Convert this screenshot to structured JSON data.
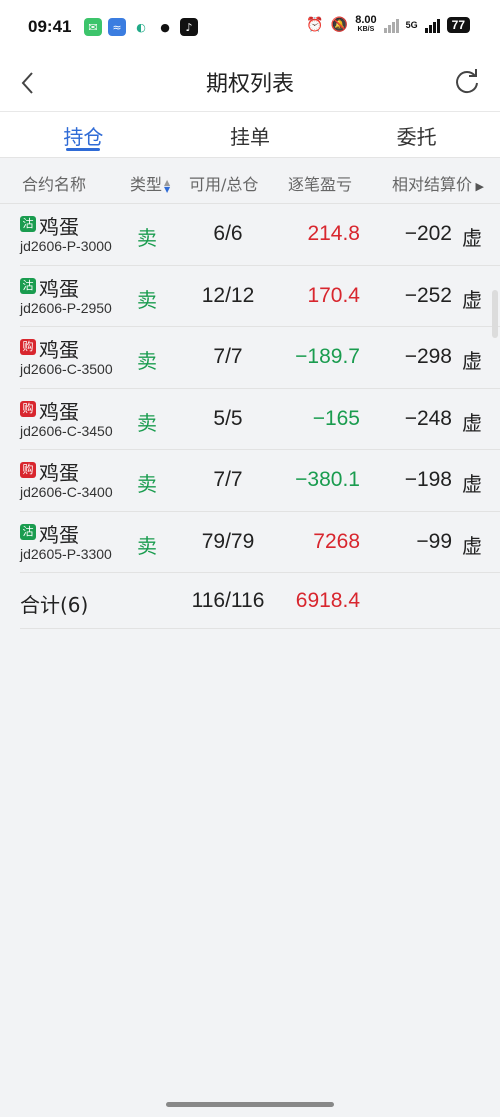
{
  "status_bar": {
    "time": "09:41",
    "speed_value": "8.00",
    "speed_unit": "KB/S",
    "network": "5G",
    "battery": "77"
  },
  "nav": {
    "title": "期权列表"
  },
  "tabs": [
    {
      "label": "持仓",
      "active": true
    },
    {
      "label": "挂单",
      "active": false
    },
    {
      "label": "委托",
      "active": false
    }
  ],
  "table": {
    "headers": {
      "contract": "合约名称",
      "type": "类型",
      "available_total": "可用/总仓",
      "pnl": "逐笔盈亏",
      "relative_settle": "相对结算价"
    },
    "rows": [
      {
        "badge": "沽",
        "badge_kind": "gu",
        "name": "鸡蛋",
        "code": "jd2606-P-3000",
        "type": "卖",
        "qty": "6/6",
        "pnl": "214.8",
        "pnl_sign": "pos",
        "rel": "−202",
        "virt": "虚"
      },
      {
        "badge": "沽",
        "badge_kind": "gu",
        "name": "鸡蛋",
        "code": "jd2606-P-2950",
        "type": "卖",
        "qty": "12/12",
        "pnl": "170.4",
        "pnl_sign": "pos",
        "rel": "−252",
        "virt": "虚"
      },
      {
        "badge": "购",
        "badge_kind": "gou",
        "name": "鸡蛋",
        "code": "jd2606-C-3500",
        "type": "卖",
        "qty": "7/7",
        "pnl": "−189.7",
        "pnl_sign": "neg",
        "rel": "−298",
        "virt": "虚"
      },
      {
        "badge": "购",
        "badge_kind": "gou",
        "name": "鸡蛋",
        "code": "jd2606-C-3450",
        "type": "卖",
        "qty": "5/5",
        "pnl": "−165",
        "pnl_sign": "neg",
        "rel": "−248",
        "virt": "虚"
      },
      {
        "badge": "购",
        "badge_kind": "gou",
        "name": "鸡蛋",
        "code": "jd2606-C-3400",
        "type": "卖",
        "qty": "7/7",
        "pnl": "−380.1",
        "pnl_sign": "neg",
        "rel": "−198",
        "virt": "虚"
      },
      {
        "badge": "沽",
        "badge_kind": "gu",
        "name": "鸡蛋",
        "code": "jd2605-P-3300",
        "type": "卖",
        "qty": "79/79",
        "pnl": "7268",
        "pnl_sign": "pos",
        "rel": "−99",
        "virt": "虚"
      }
    ],
    "total": {
      "label": "合计(6)",
      "qty": "116/116",
      "pnl": "6918.4"
    }
  },
  "colors": {
    "accent": "#2f6bd6",
    "profit": "#d8262e",
    "loss": "#1a9c4f"
  }
}
